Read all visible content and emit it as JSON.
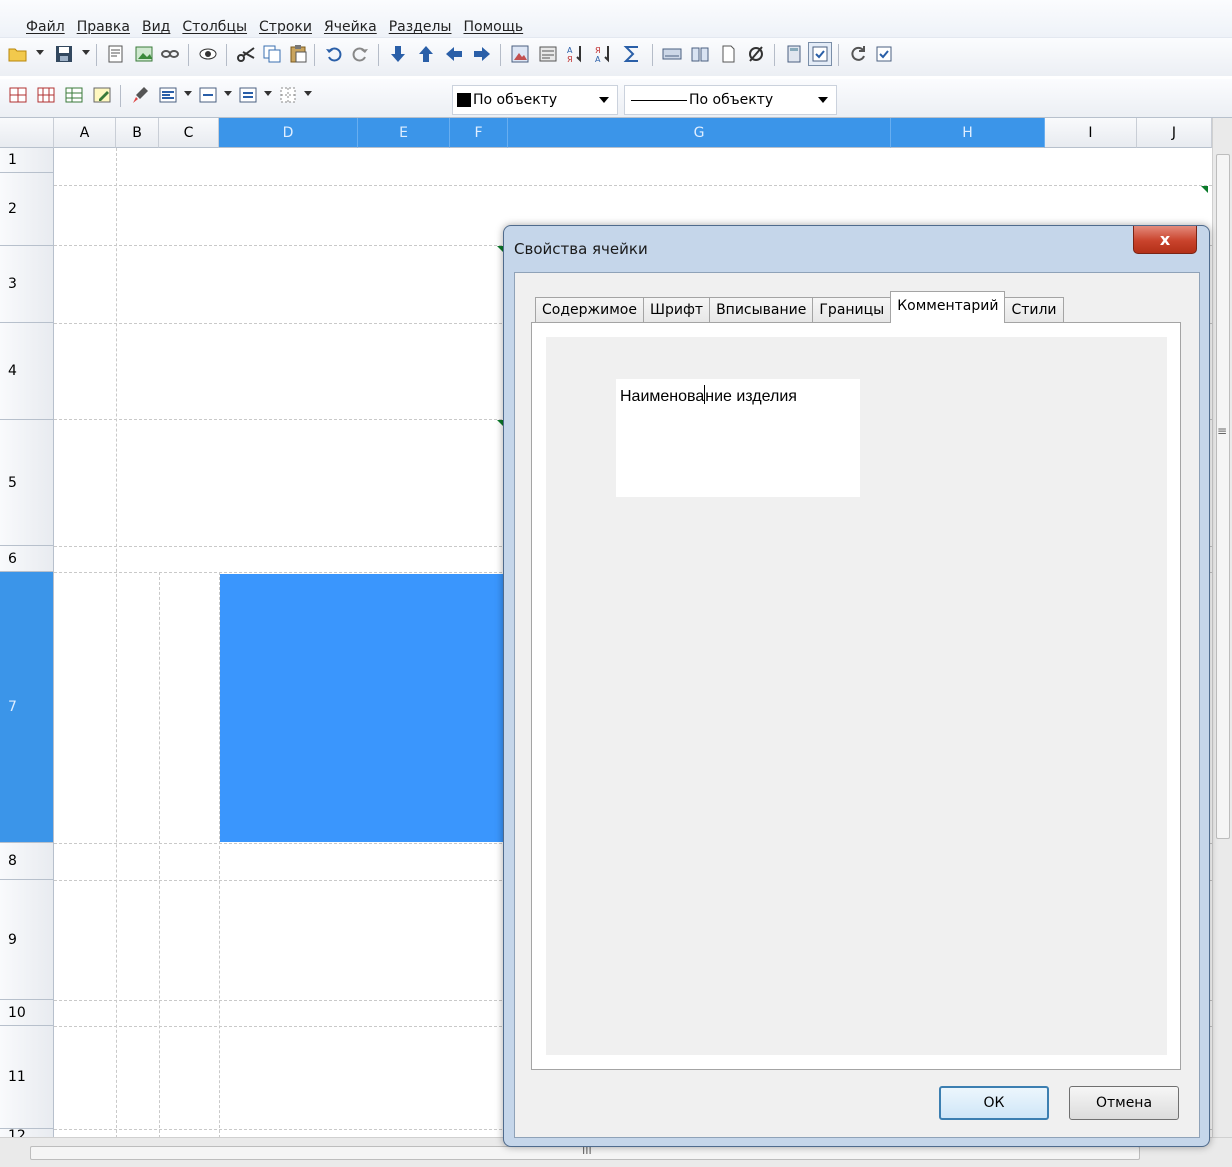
{
  "menu": [
    "Файл",
    "Правка",
    "Вид",
    "Столбцы",
    "Строки",
    "Ячейка",
    "Разделы",
    "Помощь"
  ],
  "toolbar": {
    "color_combo": "По объекту",
    "line_combo": "По объекту"
  },
  "columns": [
    "A",
    "B",
    "C",
    "D",
    "E",
    "F",
    "G",
    "H",
    "I",
    "J"
  ],
  "rows": [
    "1",
    "2",
    "3",
    "4",
    "5",
    "6",
    "7",
    "8",
    "9",
    "10",
    "11",
    "12"
  ],
  "colors": {
    "selection": "#3a96fd",
    "header_selected": "#3b95e9"
  },
  "dialog": {
    "title": "Свойства ячейки",
    "close_label": "x",
    "tabs": [
      "Содержимое",
      "Шрифт",
      "Вписывание",
      "Границы",
      "Комментарий",
      "Стили"
    ],
    "active_tab": "Комментарий",
    "comment_before_caret": "Наименова",
    "comment_after_caret": "ние изделия",
    "ok_label": "ОК",
    "cancel_label": "Отмена"
  },
  "scrollbar": {
    "h_grip": "III",
    "v_grip": "≡"
  }
}
